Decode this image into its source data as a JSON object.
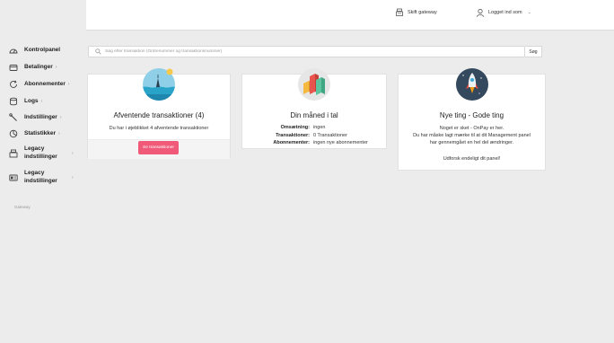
{
  "topbar": {
    "gateway_label": "Skift gateway",
    "user_label": "Logget ind som"
  },
  "sidebar": {
    "items": [
      {
        "label": "Kontrolpanel",
        "icon": "speedometer-icon"
      },
      {
        "label": "Betalinger",
        "icon": "wallet-icon"
      },
      {
        "label": "Abonnementer",
        "icon": "refresh-icon"
      },
      {
        "label": "Logs",
        "icon": "database-icon"
      },
      {
        "label": "Indstillinger",
        "icon": "wrench-icon"
      },
      {
        "label": "Statistikker",
        "icon": "pie-chart-icon"
      },
      {
        "label": "Legacy indstillinger",
        "icon": "cash-register-icon"
      },
      {
        "label": "Legacy indstillinger",
        "icon": "id-card-icon"
      }
    ],
    "footer_label": "Gateway"
  },
  "search": {
    "placeholder": "Søg efter transaktion (Ordrenummer og transaktionsnummer)",
    "button_label": "Søg"
  },
  "cards": {
    "pending": {
      "title": "Afventende transaktioner (4)",
      "text": "Du har i øjeblikket 4 afventende transaktioner",
      "button_label": "Se transaktioner"
    },
    "month": {
      "title": "Din måned i tal",
      "rows": [
        {
          "key": "Omsætning:",
          "value": "ingen"
        },
        {
          "key": "Transaktioner:",
          "value": "0 Transaktioner"
        },
        {
          "key": "Abonnementer:",
          "value": "ingen nye abonnementer"
        }
      ]
    },
    "news": {
      "title": "Nye ting - Gode ting",
      "lines": [
        "Noget er sket - OnPay er her.",
        "Du har måske lagt mærke til at dit Management panel",
        "har gennemgået en hel del ændringer.",
        "",
        "Udforsk endeligt dit panel!"
      ]
    }
  },
  "colors": {
    "accent": "#f05a78",
    "background": "#ececec"
  }
}
